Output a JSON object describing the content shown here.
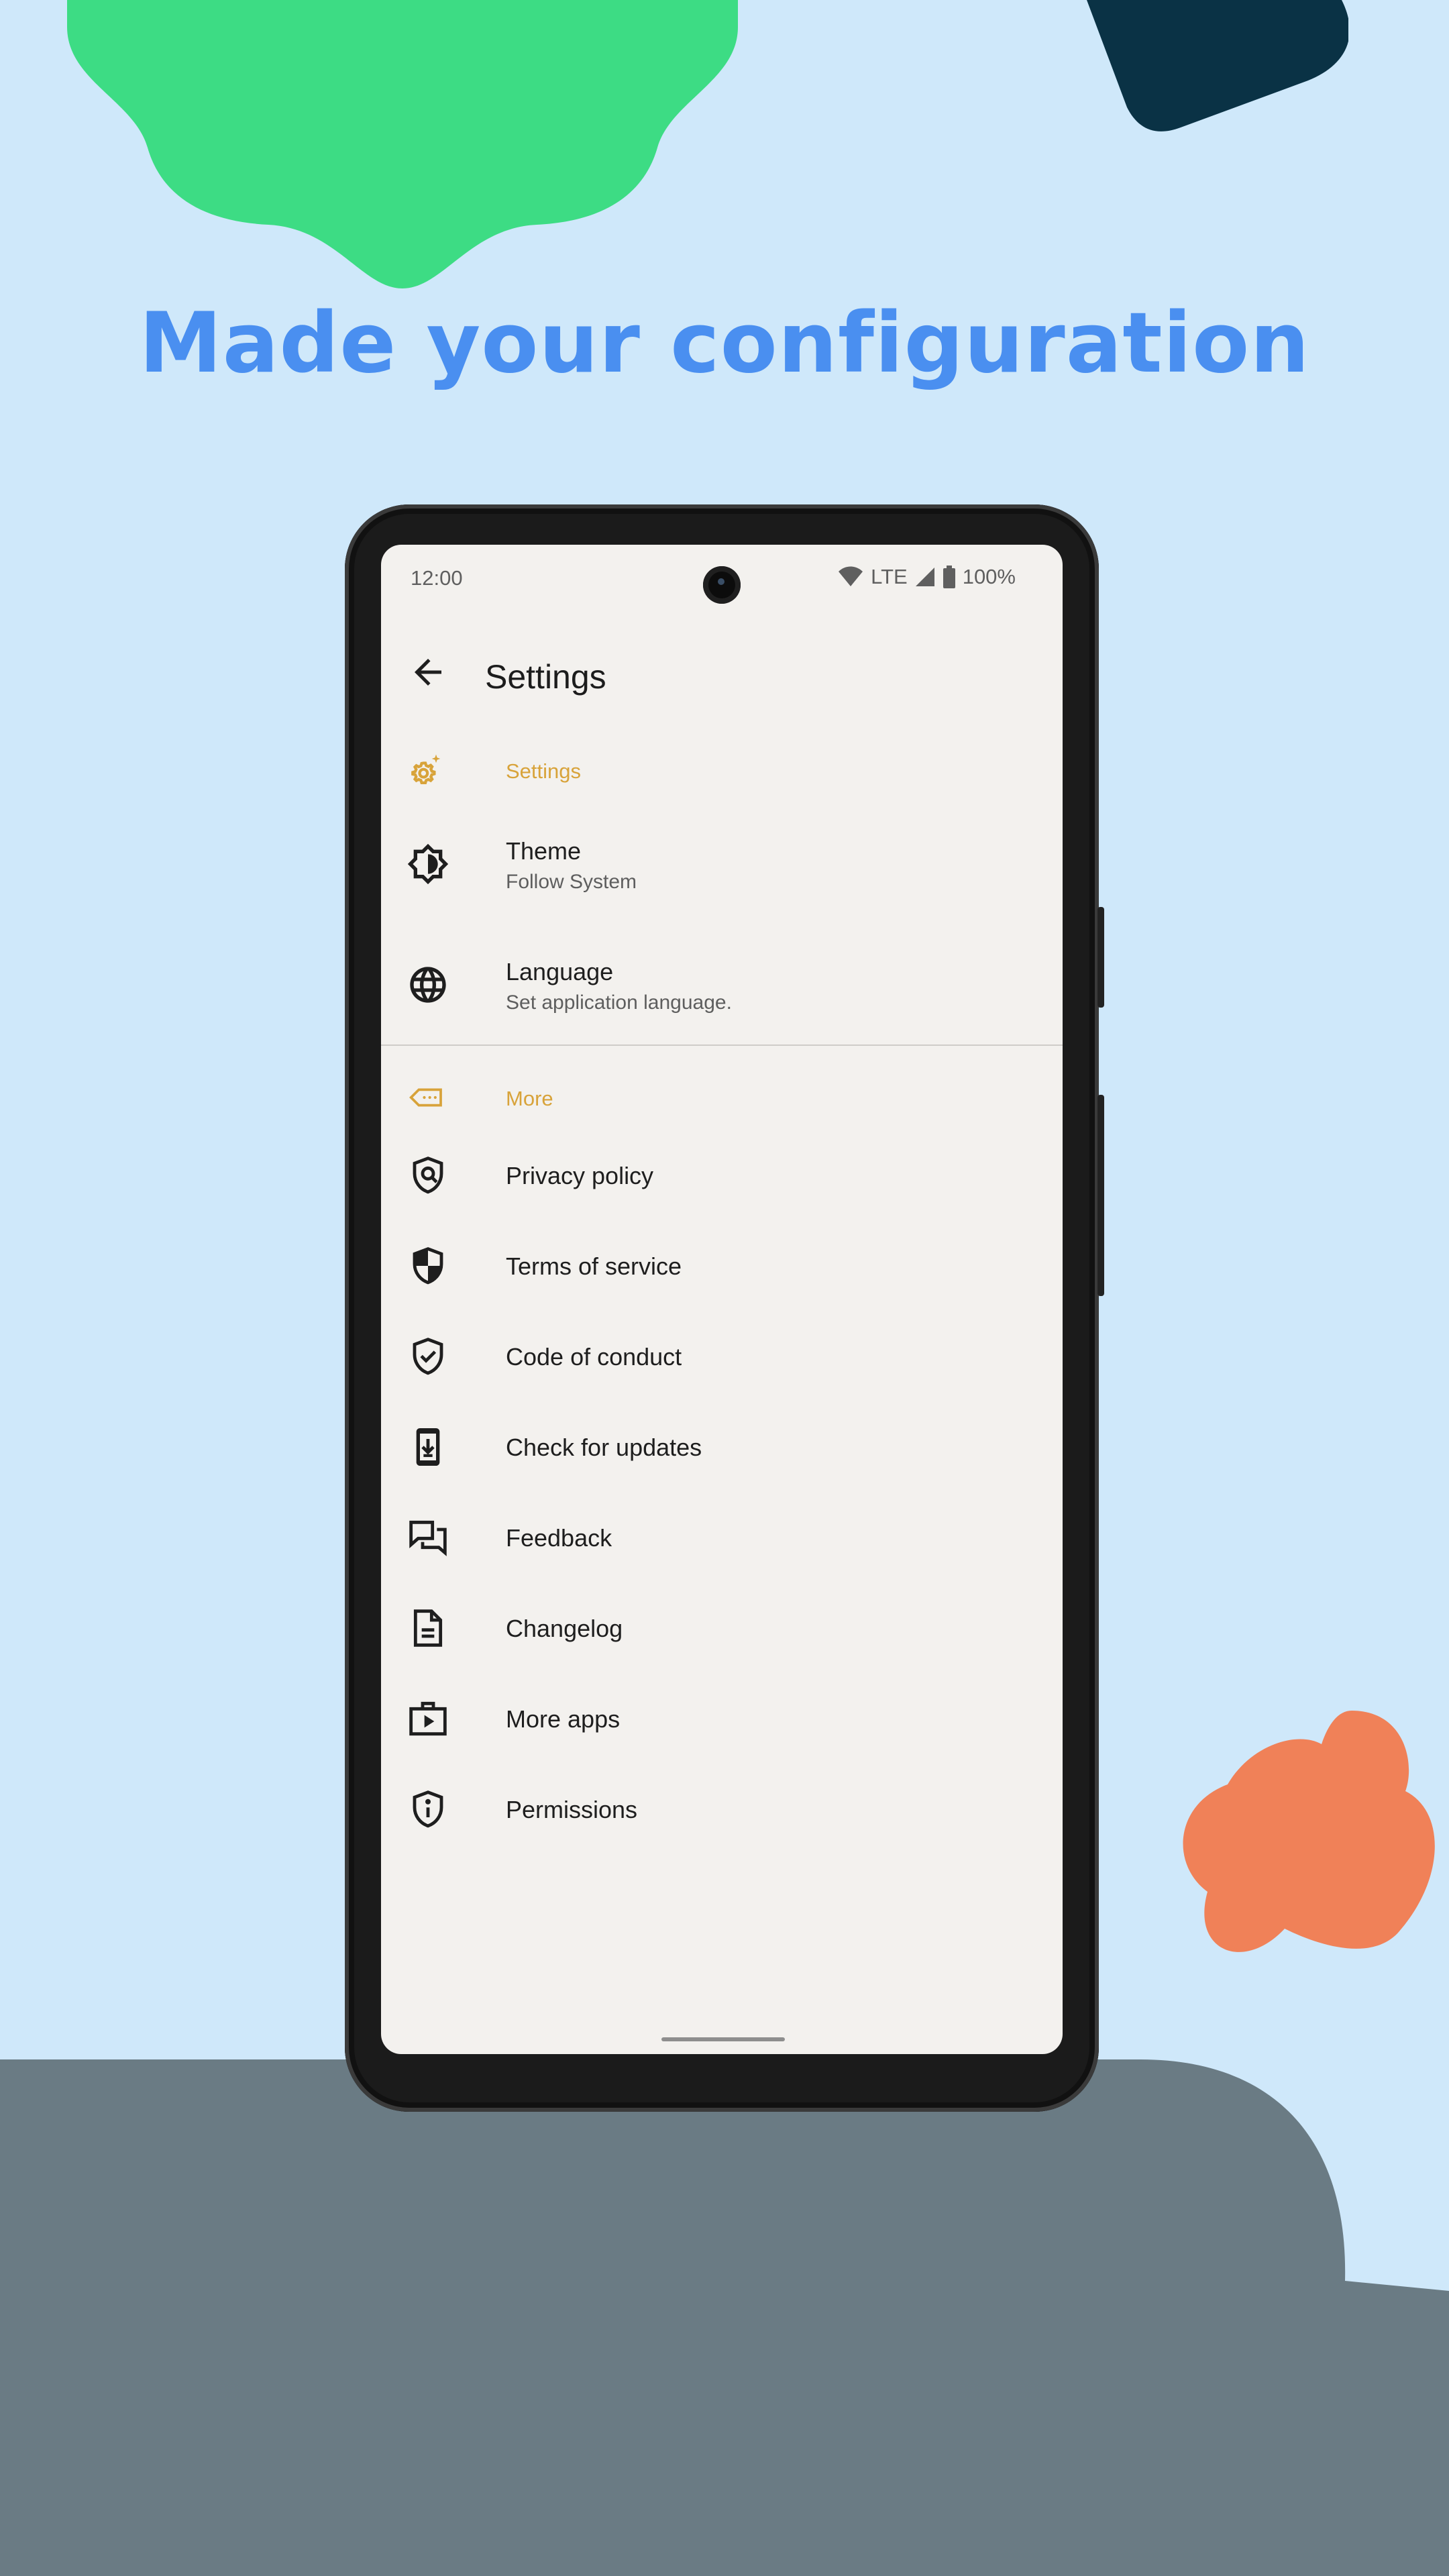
{
  "headline": "Made your configuration",
  "colors": {
    "background": "#cfe8fa",
    "headline": "#4a8ff0",
    "accent_section": "#d8a33a",
    "green_blob": "#3ddc84",
    "navy_shape": "#0a3245",
    "orange_blob": "#f08158",
    "ground": "#6a7b84",
    "screen_bg": "#f3f1ee"
  },
  "status_bar": {
    "time": "12:00",
    "network": "LTE",
    "battery": "100%"
  },
  "app_bar": {
    "title": "Settings",
    "back_icon": "arrow-back-icon"
  },
  "sections": [
    {
      "header": "Settings",
      "header_icon": "settings-sparkle-icon",
      "items": [
        {
          "title": "Theme",
          "subtitle": "Follow System",
          "icon": "theme-brightness-icon"
        },
        {
          "title": "Language",
          "subtitle": "Set application language.",
          "icon": "globe-icon"
        }
      ]
    },
    {
      "header": "More",
      "header_icon": "more-tag-icon",
      "items": [
        {
          "title": "Privacy policy",
          "icon": "privacy-shield-icon"
        },
        {
          "title": "Terms of service",
          "icon": "terms-shield-icon"
        },
        {
          "title": "Code of conduct",
          "icon": "verified-shield-icon"
        },
        {
          "title": "Check for updates",
          "icon": "phone-download-icon"
        },
        {
          "title": "Feedback",
          "icon": "chat-bubbles-icon"
        },
        {
          "title": "Changelog",
          "icon": "document-icon"
        },
        {
          "title": "More apps",
          "icon": "app-store-bag-icon"
        },
        {
          "title": "Permissions",
          "icon": "info-shield-icon"
        }
      ]
    }
  ]
}
